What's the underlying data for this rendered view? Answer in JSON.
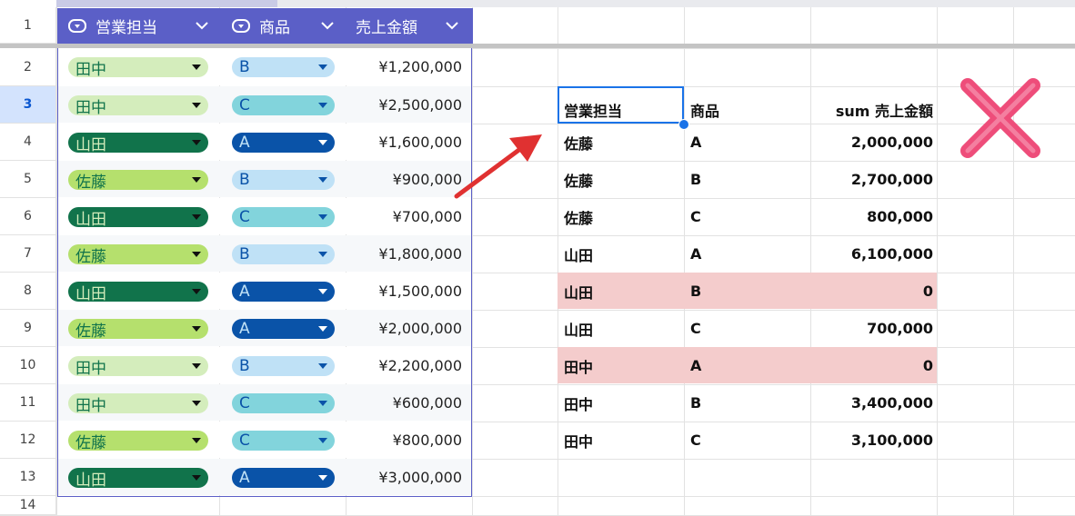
{
  "row_numbers": [
    "1",
    "2",
    "3",
    "4",
    "5",
    "6",
    "7",
    "8",
    "9",
    "10",
    "11",
    "12",
    "13",
    "14"
  ],
  "table": {
    "headers": [
      {
        "label": "営業担当",
        "icon": "dropdown-chip-icon"
      },
      {
        "label": "商品",
        "icon": "dropdown-chip-icon"
      },
      {
        "label": "売上金額"
      }
    ],
    "rows": [
      {
        "rep": "田中",
        "product": "B",
        "amount": "¥1,200,000"
      },
      {
        "rep": "田中",
        "product": "C",
        "amount": "¥2,500,000"
      },
      {
        "rep": "山田",
        "product": "A",
        "amount": "¥1,600,000"
      },
      {
        "rep": "佐藤",
        "product": "B",
        "amount": "¥900,000"
      },
      {
        "rep": "山田",
        "product": "C",
        "amount": "¥700,000"
      },
      {
        "rep": "佐藤",
        "product": "B",
        "amount": "¥1,800,000"
      },
      {
        "rep": "山田",
        "product": "A",
        "amount": "¥1,500,000"
      },
      {
        "rep": "佐藤",
        "product": "A",
        "amount": "¥2,000,000"
      },
      {
        "rep": "田中",
        "product": "B",
        "amount": "¥2,200,000"
      },
      {
        "rep": "田中",
        "product": "C",
        "amount": "¥600,000"
      },
      {
        "rep": "佐藤",
        "product": "C",
        "amount": "¥800,000"
      },
      {
        "rep": "山田",
        "product": "A",
        "amount": "¥3,000,000"
      }
    ]
  },
  "pivot": {
    "headers": [
      "営業担当",
      "商品",
      "sum 売上金額"
    ],
    "rows": [
      {
        "rep": "佐藤",
        "product": "A",
        "sum": "2,000,000",
        "highlight": false
      },
      {
        "rep": "佐藤",
        "product": "B",
        "sum": "2,700,000",
        "highlight": false
      },
      {
        "rep": "佐藤",
        "product": "C",
        "sum": "800,000",
        "highlight": false
      },
      {
        "rep": "山田",
        "product": "A",
        "sum": "6,100,000",
        "highlight": false
      },
      {
        "rep": "山田",
        "product": "B",
        "sum": "0",
        "highlight": true
      },
      {
        "rep": "山田",
        "product": "C",
        "sum": "700,000",
        "highlight": false
      },
      {
        "rep": "田中",
        "product": "A",
        "sum": "0",
        "highlight": true
      },
      {
        "rep": "田中",
        "product": "B",
        "sum": "3,400,000",
        "highlight": false
      },
      {
        "rep": "田中",
        "product": "C",
        "sum": "3,100,000",
        "highlight": false
      }
    ]
  },
  "colors": {
    "table_header": "#5b5fc7",
    "highlight": "#f4cccc",
    "arrow": "#e03131",
    "cross": "#ee4d7a",
    "selection": "#1a73e8"
  },
  "chip_colors": {
    "田中": {
      "bg": "#d4edbc",
      "fg": "#11734b"
    },
    "山田": {
      "bg": "#11734b",
      "fg": "#d4edbc"
    },
    "佐藤": {
      "bg": "#b5e06d",
      "fg": "#11734b"
    },
    "A": {
      "bg": "#0a53a8",
      "fg": "#bfe1f6"
    },
    "B": {
      "bg": "#bfe1f6",
      "fg": "#0a53a8"
    },
    "C": {
      "bg": "#82d4dc",
      "fg": "#0a53a8"
    }
  },
  "annotations": {
    "arrow_icon": "red-arrow-icon",
    "cross_icon": "red-cross-icon"
  }
}
